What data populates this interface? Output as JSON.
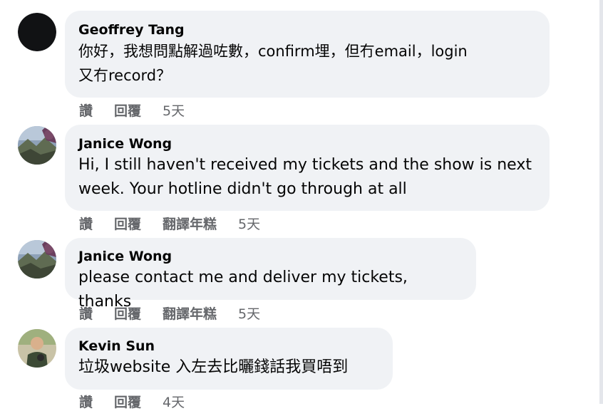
{
  "comments": [
    {
      "author": "Geoffrey Tang",
      "text": "你好，我想問點解過咗數，confirm埋，但冇email，login\n又冇record？",
      "actions": {
        "like": "讚",
        "reply": "回覆"
      },
      "time": "5天",
      "avatar": "dark-avatar-icon"
    },
    {
      "author": "Janice Wong",
      "text": "Hi, I still haven't received my tickets and the show is next\nweek. Your hotline didn't go through at all",
      "actions": {
        "like": "讚",
        "reply": "回覆",
        "translate": "翻譯年糕"
      },
      "time": "5天",
      "avatar": "landscape-avatar-icon"
    },
    {
      "author": "Janice Wong",
      "text": "please contact me and deliver my tickets, thanks",
      "actions": {
        "like": "讚",
        "reply": "回覆",
        "translate": "翻譯年糕"
      },
      "time": "5天",
      "avatar": "landscape-avatar-icon"
    },
    {
      "author": "Kevin Sun",
      "text": "垃圾website 入左去比曬錢話我買唔到",
      "actions": {
        "like": "讚",
        "reply": "回覆"
      },
      "time": "4天",
      "avatar": "person-avatar-icon"
    }
  ],
  "colors": {
    "bubble": "#f0f2f5",
    "text": "#050505",
    "muted": "#65676b"
  }
}
